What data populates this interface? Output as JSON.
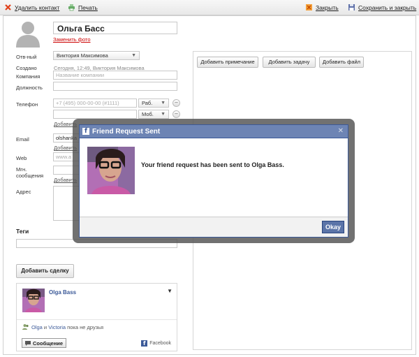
{
  "toolbar": {
    "delete_label": "Удалить контакт",
    "print_label": "Печать",
    "close_label": "Закрыть",
    "save_close_label": "Сохранить и закрыть"
  },
  "contact": {
    "name": "Ольга Басс",
    "change_photo": "Заменить фото"
  },
  "fields": {
    "owner_label": "Отв-ный",
    "owner_value": "Виктория Максимова",
    "created_label": "Создано",
    "created_value": "Сегодня, 12:49, Виктория Максимова",
    "company_label": "Компания",
    "company_placeholder": "Название компании",
    "position_label": "Должность",
    "phone_label": "Телефон",
    "phone_placeholder": "+7 (495) 000-00-00 (#1111)",
    "phone_type_1": "Раб.",
    "phone_type_2": "Моб.",
    "add_label": "Добавить",
    "email_label": "Email",
    "email_value": "olshanka",
    "web_label": "Web",
    "web_placeholder": "www.a",
    "im_label_1": "Мгн.",
    "im_label_2": "сообщения",
    "address_label": "Адрес",
    "tags_label": "Теги",
    "add_deal": "Добавить сделку"
  },
  "right_panel": {
    "add_note": "Добавить примечание",
    "add_task": "Добавить задачу",
    "add_file": "Добавить файл"
  },
  "facebook_widget": {
    "name": "Olga Bass",
    "friends_name_1": "Olga",
    "friends_text": " и ",
    "friends_name_2": "Victoria",
    "friends_suffix": " пока не друзья",
    "message_button": "Сообщение",
    "brand": "Facebook"
  },
  "modal": {
    "title": "Friend Request Sent",
    "message": "Your friend request has been sent to Olga Bass.",
    "okay": "Okay"
  },
  "colors": {
    "facebook_blue": "#3b5998",
    "modal_header": "#6d84b4",
    "link_red": "#cc0000"
  }
}
